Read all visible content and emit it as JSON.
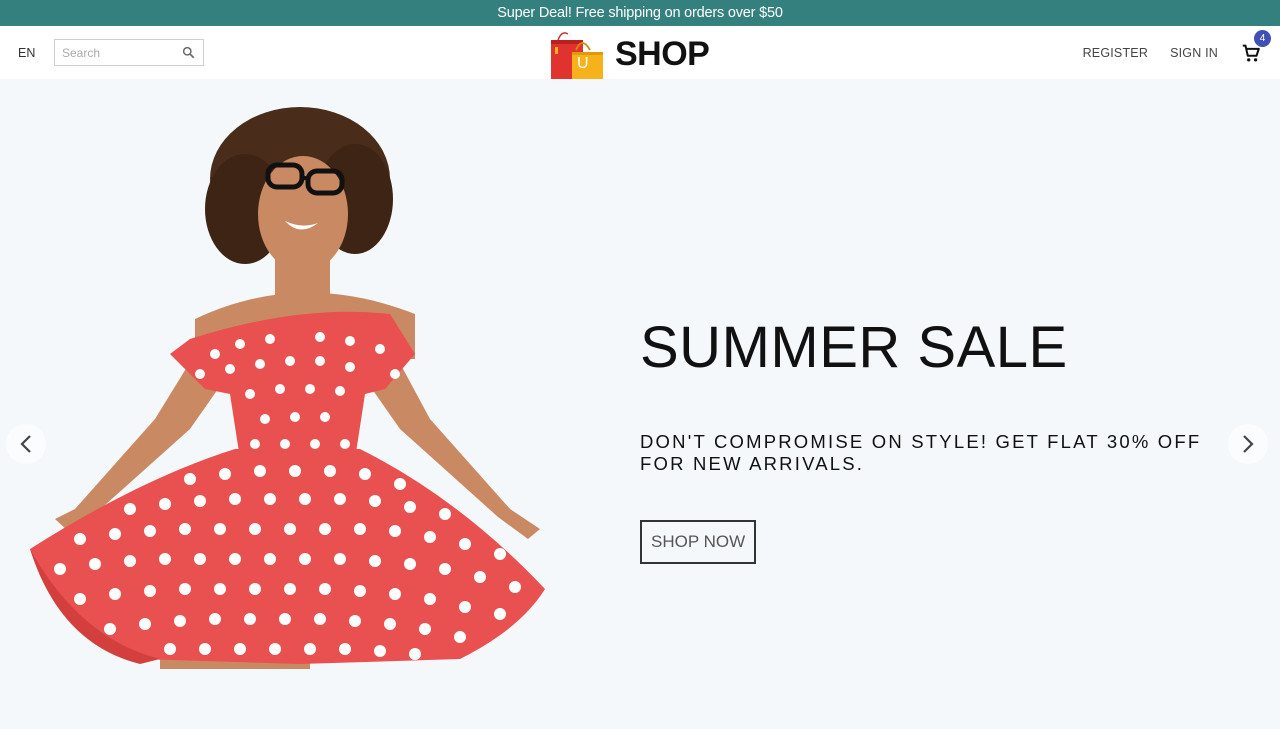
{
  "announcement": {
    "text": "Super Deal! Free shipping on orders over $50"
  },
  "navbar": {
    "language": "EN",
    "search": {
      "placeholder": "Search",
      "value": ""
    },
    "logo": {
      "bag_letter": "U",
      "brand": "SHOP"
    },
    "register_label": "REGISTER",
    "signin_label": "SIGN IN",
    "cart": {
      "count": "4"
    }
  },
  "hero": {
    "title": "SUMMER SALE",
    "subtitle": "DON'T COMPROMISE ON STYLE! GET FLAT 30% OFF FOR NEW ARRIVALS.",
    "cta_label": "SHOP NOW",
    "image": "woman-red-polka-dot-dress"
  },
  "colors": {
    "announce_bg": "#34807e",
    "hero_bg": "#f5f8fa",
    "badge": "#3f51b5",
    "dress": "#e8514f"
  },
  "icons": [
    "search-icon",
    "cart-icon",
    "chevron-left-icon",
    "chevron-right-icon"
  ]
}
